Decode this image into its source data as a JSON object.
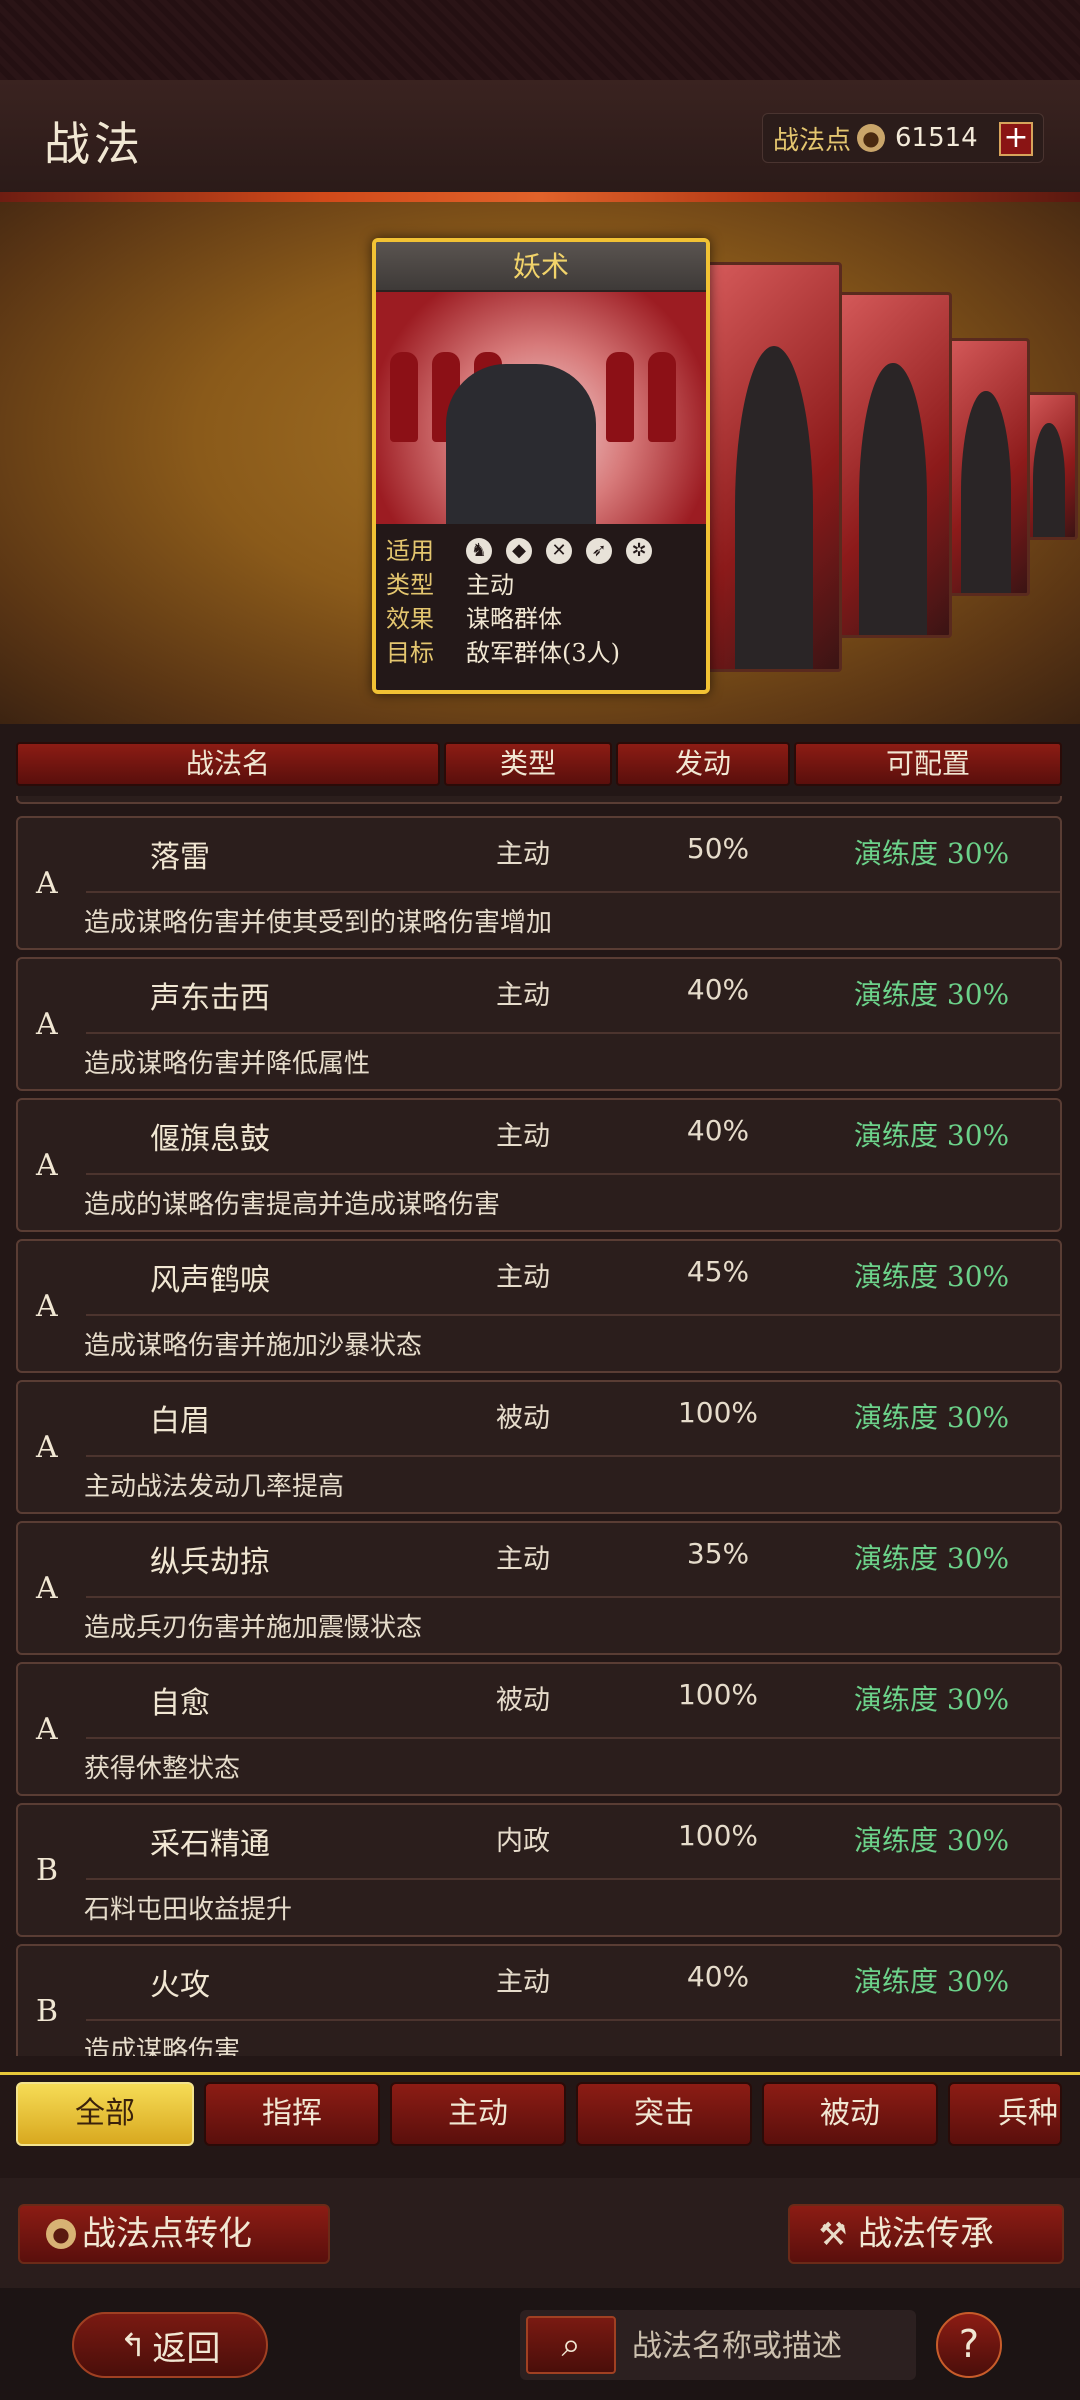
{
  "header": {
    "title": "战法",
    "points_label": "战法点",
    "points_value": "61514",
    "plus_symbol": "+"
  },
  "selected_card": {
    "name": "妖术",
    "applicable_label": "适用",
    "type_label": "类型",
    "type_value": "主动",
    "effect_label": "效果",
    "effect_value": "谋略群体",
    "target_label": "目标",
    "target_value": "敌军群体(3人)",
    "unit_icons": [
      "cavalry-icon",
      "shield-icon",
      "bow-icon",
      "spear-icon",
      "wheel-icon"
    ]
  },
  "columns": {
    "name": "战法名",
    "type": "类型",
    "rate": "发动",
    "configurable": "可配置"
  },
  "tactics": [
    {
      "grade": "A",
      "name": "落雷",
      "type": "主动",
      "rate": "50%",
      "proficiency": "演练度 30%",
      "desc": "造成谋略伤害并使其受到的谋略伤害增加"
    },
    {
      "grade": "A",
      "name": "声东击西",
      "type": "主动",
      "rate": "40%",
      "proficiency": "演练度 30%",
      "desc": "造成谋略伤害并降低属性"
    },
    {
      "grade": "A",
      "name": "偃旗息鼓",
      "type": "主动",
      "rate": "40%",
      "proficiency": "演练度 30%",
      "desc": "造成的谋略伤害提高并造成谋略伤害"
    },
    {
      "grade": "A",
      "name": "风声鹤唳",
      "type": "主动",
      "rate": "45%",
      "proficiency": "演练度 30%",
      "desc": "造成谋略伤害并施加沙暴状态"
    },
    {
      "grade": "A",
      "name": "白眉",
      "type": "被动",
      "rate": "100%",
      "proficiency": "演练度 30%",
      "desc": "主动战法发动几率提高"
    },
    {
      "grade": "A",
      "name": "纵兵劫掠",
      "type": "主动",
      "rate": "35%",
      "proficiency": "演练度 30%",
      "desc": "造成兵刃伤害并施加震慑状态"
    },
    {
      "grade": "A",
      "name": "自愈",
      "type": "被动",
      "rate": "100%",
      "proficiency": "演练度 30%",
      "desc": "获得休整状态"
    },
    {
      "grade": "B",
      "name": "采石精通",
      "type": "内政",
      "rate": "100%",
      "proficiency": "演练度 30%",
      "desc": "石料屯田收益提升"
    },
    {
      "grade": "B",
      "name": "火攻",
      "type": "主动",
      "rate": "40%",
      "proficiency": "演练度 30%",
      "desc": "造成谋略伤害"
    }
  ],
  "tabs": [
    "全部",
    "指挥",
    "主动",
    "突击",
    "被动",
    "兵种"
  ],
  "actions": {
    "convert": "战法点转化",
    "inherit": "战法传承"
  },
  "bottom": {
    "back": "返回",
    "search_placeholder": "战法名称或描述",
    "help": "?"
  }
}
